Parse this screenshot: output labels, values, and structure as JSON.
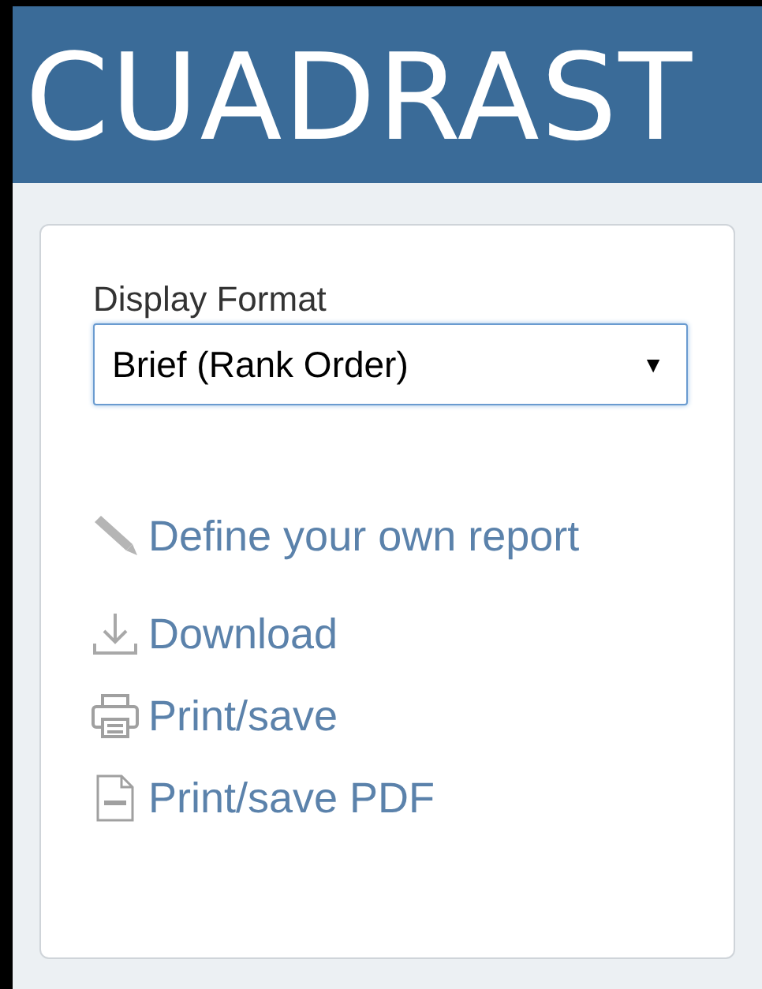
{
  "header": {
    "logo_text": "CUADRAST"
  },
  "display_format": {
    "label": "Display Format",
    "value": "Brief (Rank Order)",
    "arrow": "▼"
  },
  "actions": [
    {
      "kind": "pencil",
      "label": "Define your own report"
    },
    {
      "kind": "download",
      "label": "Download"
    },
    {
      "kind": "print",
      "label": "Print/save"
    },
    {
      "kind": "pdf",
      "label": "Print/save PDF"
    }
  ]
}
